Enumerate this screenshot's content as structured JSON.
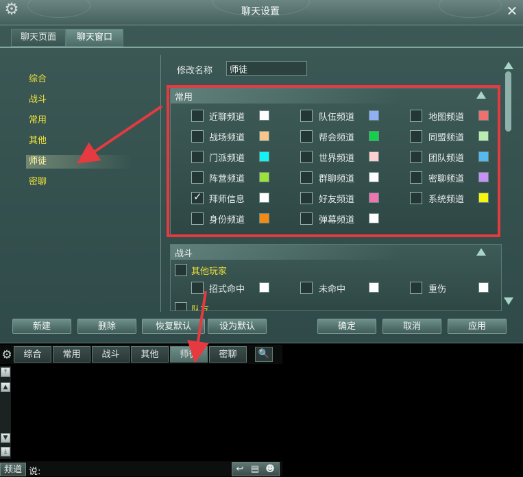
{
  "window": {
    "title": "聊天设置",
    "tabs": [
      {
        "label": "聊天页面",
        "active": false
      },
      {
        "label": "聊天窗口",
        "active": true
      }
    ]
  },
  "sidebar": {
    "items": [
      {
        "label": "综合",
        "selected": false
      },
      {
        "label": "战斗",
        "selected": false
      },
      {
        "label": "常用",
        "selected": false
      },
      {
        "label": "其他",
        "selected": false
      },
      {
        "label": "师徒",
        "selected": true
      },
      {
        "label": "密聊",
        "selected": false
      }
    ]
  },
  "rename": {
    "label": "修改名称",
    "value": "师徒"
  },
  "sections": {
    "common": {
      "title": "常用",
      "channels": [
        {
          "label": "近聊频道",
          "checked": false,
          "color": "#ffffff"
        },
        {
          "label": "队伍频道",
          "checked": false,
          "color": "#8fb0f5"
        },
        {
          "label": "地图频道",
          "checked": false,
          "color": "#f06f6f"
        },
        {
          "label": "战场频道",
          "checked": false,
          "color": "#f7c58e"
        },
        {
          "label": "帮会频道",
          "checked": false,
          "color": "#14d04c"
        },
        {
          "label": "同盟频道",
          "checked": false,
          "color": "#b9eeb0"
        },
        {
          "label": "门派频道",
          "checked": false,
          "color": "#12f2f2"
        },
        {
          "label": "世界频道",
          "checked": false,
          "color": "#fbd0cf"
        },
        {
          "label": "团队频道",
          "checked": false,
          "color": "#55b8ef"
        },
        {
          "label": "阵营频道",
          "checked": false,
          "color": "#9be23a"
        },
        {
          "label": "群聊频道",
          "checked": false,
          "color": "#ffffff"
        },
        {
          "label": "密聊频道",
          "checked": false,
          "color": "#c690f5"
        },
        {
          "label": "拜师信息",
          "checked": true,
          "color": "#ffffff"
        },
        {
          "label": "好友频道",
          "checked": false,
          "color": "#ef75b0"
        },
        {
          "label": "系统频道",
          "checked": false,
          "color": "#f5f510"
        },
        {
          "label": "身份频道",
          "checked": false,
          "color": "#f58a12"
        },
        {
          "label": "弹幕频道",
          "checked": false,
          "color": "#ffffff"
        }
      ]
    },
    "combat": {
      "title": "战斗",
      "group_label": "其他玩家",
      "channels": [
        {
          "label": "招式命中",
          "checked": false,
          "color": "#ffffff"
        },
        {
          "label": "未命中",
          "checked": false,
          "color": "#ffffff"
        },
        {
          "label": "重伤",
          "checked": false,
          "color": "#ffffff"
        }
      ],
      "next_group_label": "队友"
    }
  },
  "buttons": {
    "new": "新建",
    "delete": "删除",
    "restore_default": "恢复默认",
    "set_default": "设为默认",
    "ok": "确定",
    "cancel": "取消",
    "apply": "应用"
  },
  "chat": {
    "tabs": [
      {
        "label": "综合",
        "active": false
      },
      {
        "label": "常用",
        "active": false
      },
      {
        "label": "战斗",
        "active": false
      },
      {
        "label": "其他",
        "active": false
      },
      {
        "label": "师徒",
        "active": true
      },
      {
        "label": "密聊",
        "active": false
      }
    ],
    "channel_button": "频道",
    "say_label": "说:"
  },
  "annotation_color": "#e53a3f"
}
